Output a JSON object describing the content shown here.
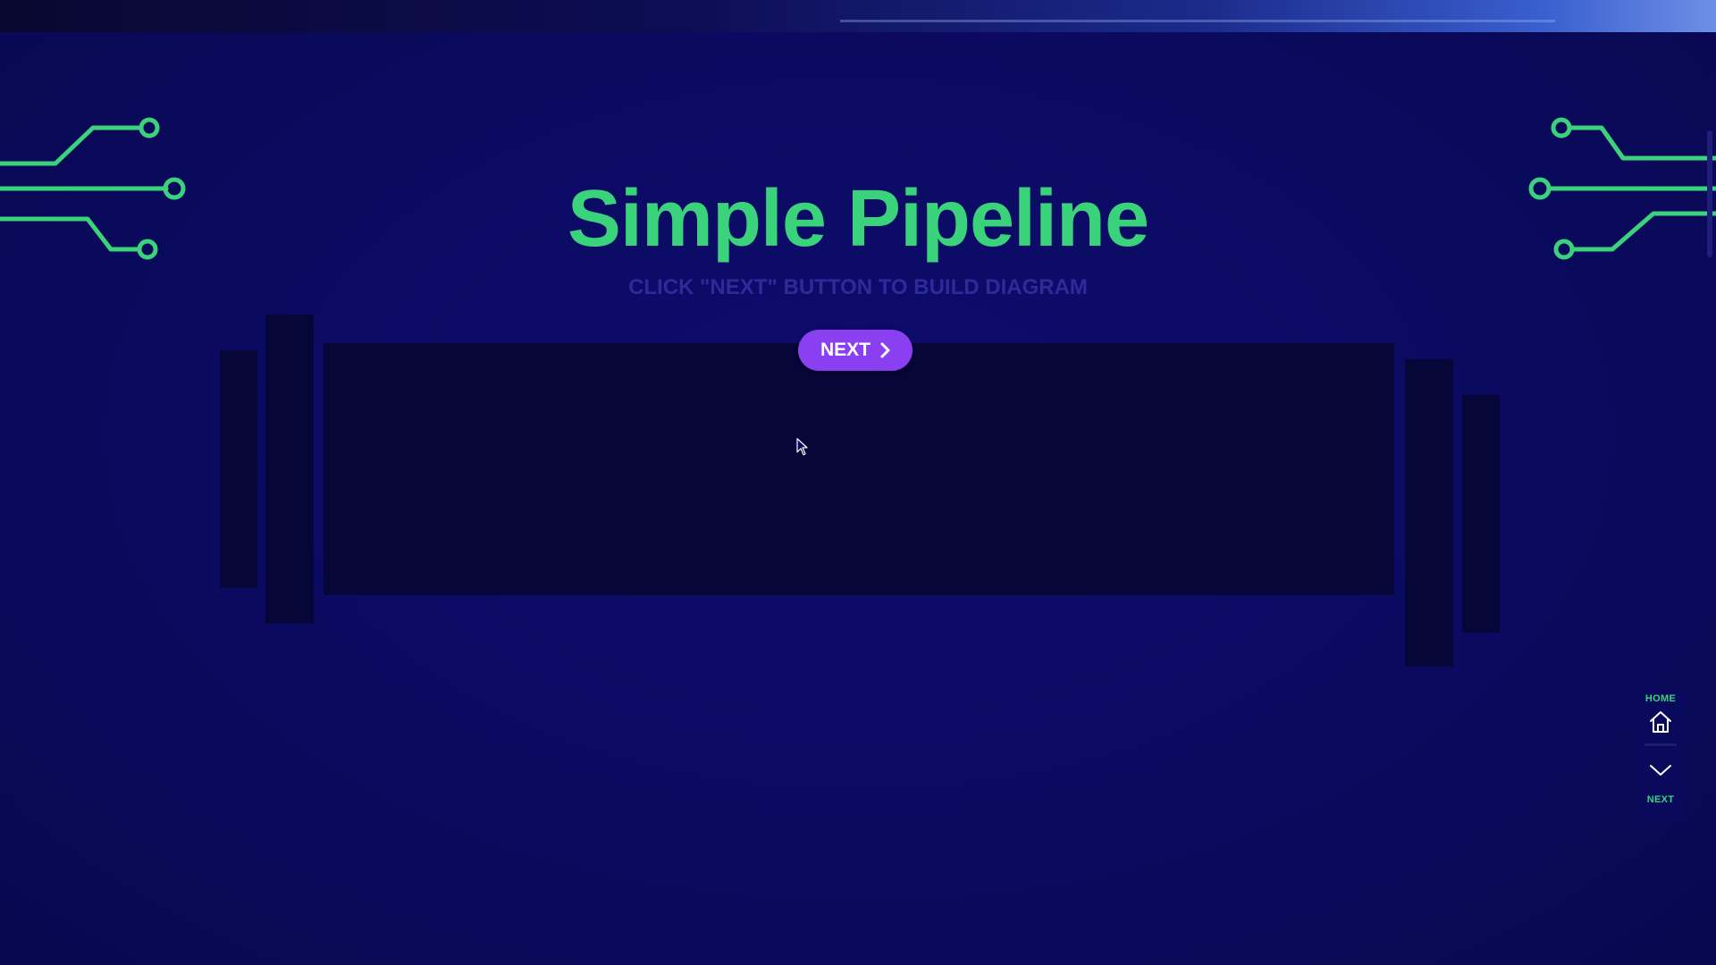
{
  "header": {
    "title": "Simple Pipeline",
    "subtitle": "CLICK \"NEXT\" BUTTON TO BUILD DIAGRAM"
  },
  "controls": {
    "next_label": "NEXT"
  },
  "side_nav": {
    "home_label": "HOME",
    "next_label": "NEXT"
  },
  "colors": {
    "background": "#0b0a60",
    "accent_green": "#3ad37c",
    "button_purple": "#8a3ff0",
    "panel_dark": "#060638"
  },
  "icons": [
    "circuit-decoration-icon",
    "chevron-right-icon",
    "home-icon",
    "chevron-down-icon",
    "mouse-cursor-icon"
  ]
}
